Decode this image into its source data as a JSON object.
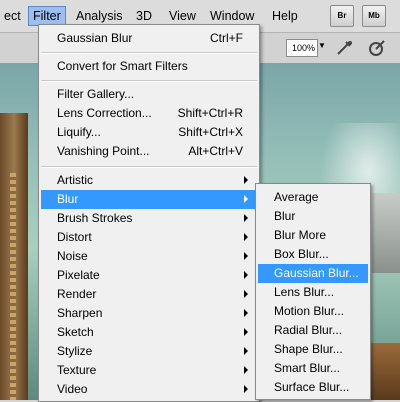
{
  "menubar": {
    "items": [
      "ect",
      "Filter",
      "Analysis",
      "3D",
      "View",
      "Window",
      "Help"
    ],
    "bridge_button": "Br",
    "minibridge_button": "Mb"
  },
  "options": {
    "zoom": "100%"
  },
  "filter_menu": {
    "items": [
      {
        "label": "Gaussian Blur",
        "shortcut": "Ctrl+F"
      },
      {
        "label": "Convert for Smart Filters",
        "shortcut": ""
      },
      {
        "label": "Filter Gallery...",
        "shortcut": ""
      },
      {
        "label": "Lens Correction...",
        "shortcut": "Shift+Ctrl+R"
      },
      {
        "label": "Liquify...",
        "shortcut": "Shift+Ctrl+X"
      },
      {
        "label": "Vanishing Point...",
        "shortcut": "Alt+Ctrl+V"
      },
      {
        "label": "Artistic",
        "submenu": true
      },
      {
        "label": "Blur",
        "submenu": true,
        "highlighted": true
      },
      {
        "label": "Brush Strokes",
        "submenu": true
      },
      {
        "label": "Distort",
        "submenu": true
      },
      {
        "label": "Noise",
        "submenu": true
      },
      {
        "label": "Pixelate",
        "submenu": true
      },
      {
        "label": "Render",
        "submenu": true
      },
      {
        "label": "Sharpen",
        "submenu": true
      },
      {
        "label": "Sketch",
        "submenu": true
      },
      {
        "label": "Stylize",
        "submenu": true
      },
      {
        "label": "Texture",
        "submenu": true
      },
      {
        "label": "Video",
        "submenu": true
      }
    ]
  },
  "blur_submenu": {
    "items": [
      "Average",
      "Blur",
      "Blur More",
      "Box Blur...",
      "Gaussian Blur...",
      "Lens Blur...",
      "Motion Blur...",
      "Radial Blur...",
      "Shape Blur...",
      "Smart Blur...",
      "Surface Blur..."
    ],
    "highlighted": "Gaussian Blur..."
  }
}
